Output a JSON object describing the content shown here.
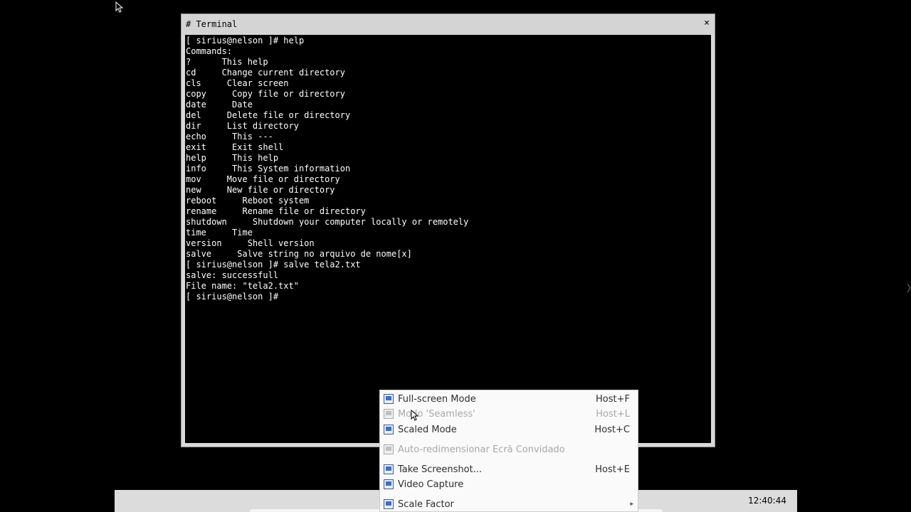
{
  "terminal": {
    "title": "# Terminal",
    "close_label": "×",
    "lines": [
      "[ sirius@nelson ]# help",
      "Commands:",
      "?      This help",
      "cd     Change current directory",
      "cls     Clear screen",
      "copy     Copy file or directory",
      "date     Date",
      "del     Delete file or directory",
      "dir     List directory",
      "echo     This ---",
      "exit     Exit shell",
      "help     This help",
      "info     This System information",
      "mov     Move file or directory",
      "new     New file or directory",
      "reboot     Reboot system",
      "rename     Rename file or directory",
      "shutdown     Shutdown your computer locally or remotely",
      "time     Time",
      "version     Shell version",
      "salve     Salve string no arquivo de nome[x]",
      "[ sirius@nelson ]# salve tela2.txt",
      "salve: successfull",
      "File name: \"tela2.txt\"",
      "[ sirius@nelson ]#"
    ]
  },
  "taskbar": {
    "clock": "12:40:44"
  },
  "menu": {
    "items": [
      {
        "label": "Full-screen Mode",
        "shortcut": "Host+F",
        "icon": "fullscreen-icon",
        "disabled": false,
        "submenu": false
      },
      {
        "label": "Modo 'Seamless'",
        "shortcut": "Host+L",
        "icon": "seamless-icon",
        "disabled": true,
        "submenu": false
      },
      {
        "label": "Scaled Mode",
        "shortcut": "Host+C",
        "icon": "scaled-icon",
        "disabled": false,
        "submenu": false
      },
      {
        "label": "Auto-redimensionar Ecrã Convidado",
        "shortcut": "",
        "icon": "auto-resize-icon",
        "disabled": true,
        "submenu": false
      },
      {
        "label": "Take Screenshot...",
        "shortcut": "Host+E",
        "icon": "screenshot-icon",
        "disabled": false,
        "submenu": false
      },
      {
        "label": "Video Capture",
        "shortcut": "",
        "icon": "video-capture-icon",
        "disabled": false,
        "submenu": false
      },
      {
        "label": "Scale Factor",
        "shortcut": "",
        "icon": "scale-factor-icon",
        "disabled": false,
        "submenu": true
      }
    ]
  }
}
